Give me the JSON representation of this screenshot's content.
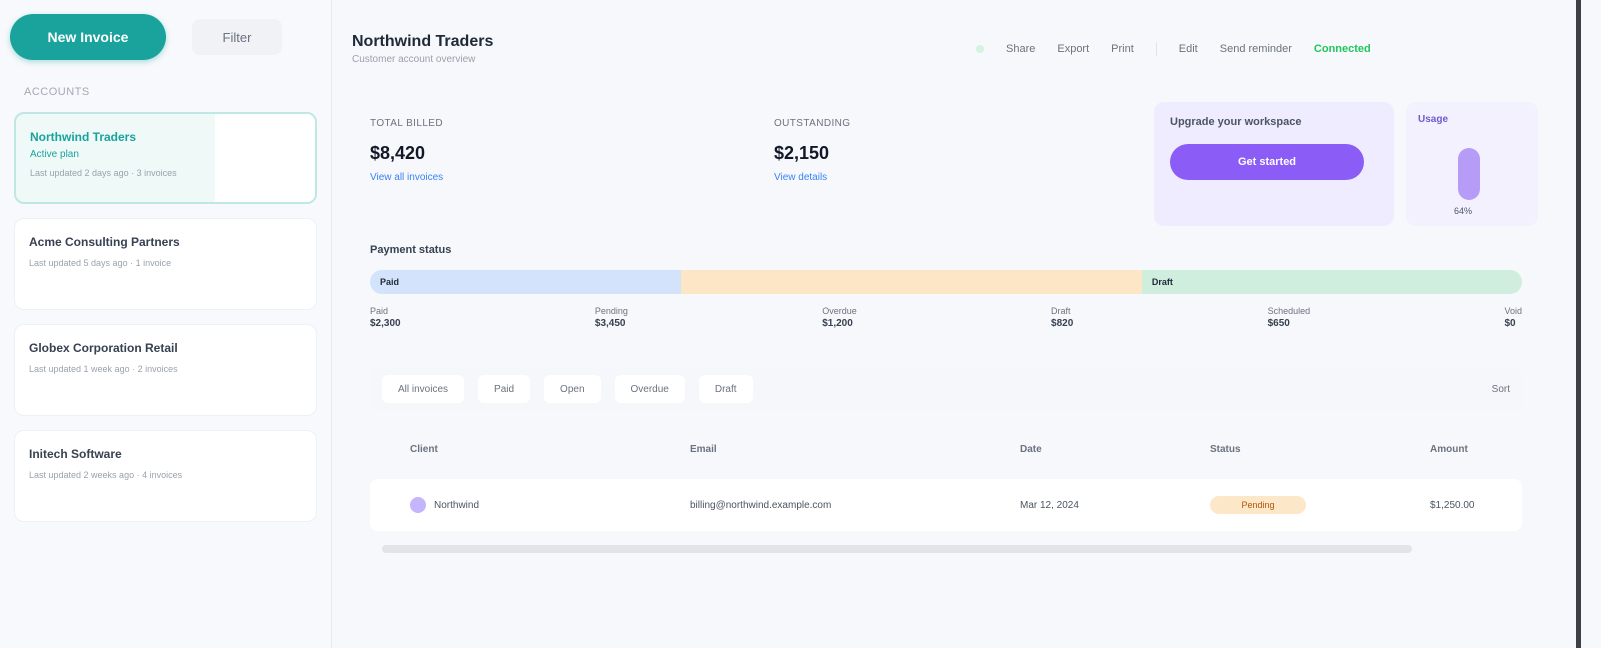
{
  "sidebar": {
    "primary_button": "New Invoice",
    "secondary_button": "Filter",
    "section_label": "Accounts",
    "cards": [
      {
        "title": "Northwind Traders",
        "sub": "Active plan",
        "meta": "Last updated 2 days ago · 3 invoices",
        "active": true
      },
      {
        "title": "Acme Consulting Partners",
        "sub": "",
        "meta": "Last updated 5 days ago · 1 invoice",
        "active": false
      },
      {
        "title": "Globex Corporation Retail",
        "sub": "",
        "meta": "Last updated 1 week ago · 2 invoices",
        "active": false
      },
      {
        "title": "Initech Software",
        "sub": "",
        "meta": "Last updated 2 weeks ago · 4 invoices",
        "active": false
      }
    ]
  },
  "header": {
    "title": "Northwind Traders",
    "subtitle": "Customer account overview",
    "actions": [
      "Share",
      "Export",
      "Print",
      "Edit",
      "Send reminder"
    ],
    "status": "Connected"
  },
  "stats": [
    {
      "label": "Total billed",
      "value": "$8,420",
      "link": "View all invoices"
    },
    {
      "label": "Outstanding",
      "value": "$2,150",
      "link": "View details"
    }
  ],
  "promo": {
    "title": "Upgrade your workspace",
    "button": "Get started"
  },
  "mini": {
    "title": "Usage",
    "label": "64%"
  },
  "breakdown": {
    "title": "Payment status",
    "segments": [
      {
        "label": "Paid",
        "share": 0.27,
        "color": "#d3e3fb"
      },
      {
        "label": "",
        "share": 0.4,
        "color": "#fde6c6"
      },
      {
        "label": "Draft",
        "share": 0.33,
        "color": "#cfeedd"
      }
    ],
    "legend": [
      {
        "label": "Paid",
        "value": "$2,300"
      },
      {
        "label": "Pending",
        "value": "$3,450"
      },
      {
        "label": "Overdue",
        "value": "$1,200"
      },
      {
        "label": "Draft",
        "value": "$820"
      },
      {
        "label": "Scheduled",
        "value": "$650"
      },
      {
        "label": "Void",
        "value": "$0"
      }
    ]
  },
  "filters": {
    "chips": [
      "All invoices",
      "Paid",
      "Open",
      "Overdue",
      "Draft"
    ],
    "right": "Sort"
  },
  "table": {
    "headers": [
      "Client",
      "Email",
      "Date",
      "Status",
      "Amount"
    ],
    "rows": [
      {
        "client": "Northwind",
        "email": "billing@northwind.example.com",
        "date": "Mar 12, 2024",
        "status": "Pending",
        "amount": "$1,250.00"
      }
    ]
  }
}
